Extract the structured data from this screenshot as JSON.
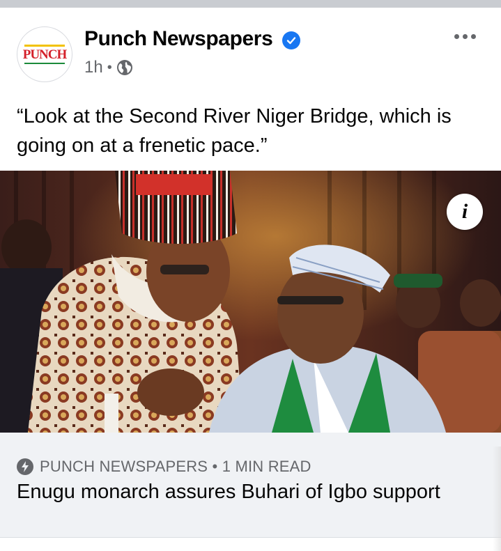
{
  "post": {
    "page_name": "Punch Newspapers",
    "verified_icon": "verified-badge-icon",
    "time": "1h",
    "separator": "•",
    "audience_icon": "globe-icon",
    "more_icon": "more-options-icon",
    "caption": "“Look at the Second River Niger Bridge, which is going on at a frenetic pace.”"
  },
  "avatar": {
    "logo_text": "PUNCH",
    "colors": {
      "red": "#d4202a",
      "yellow": "#f2c200",
      "green": "#1b8a3a"
    }
  },
  "photo": {
    "info_label": "i"
  },
  "link_preview": {
    "domain": "PUNCH NEWSPAPERS",
    "separator": "•",
    "read_time": "1 MIN READ",
    "headline": "Enugu monarch assures Buhari of Igbo support",
    "instant_icon": "lightning-bolt-icon"
  },
  "colors": {
    "accent": "#1877f2",
    "secondary_text": "#65676b",
    "preview_bg": "#f0f2f5"
  }
}
